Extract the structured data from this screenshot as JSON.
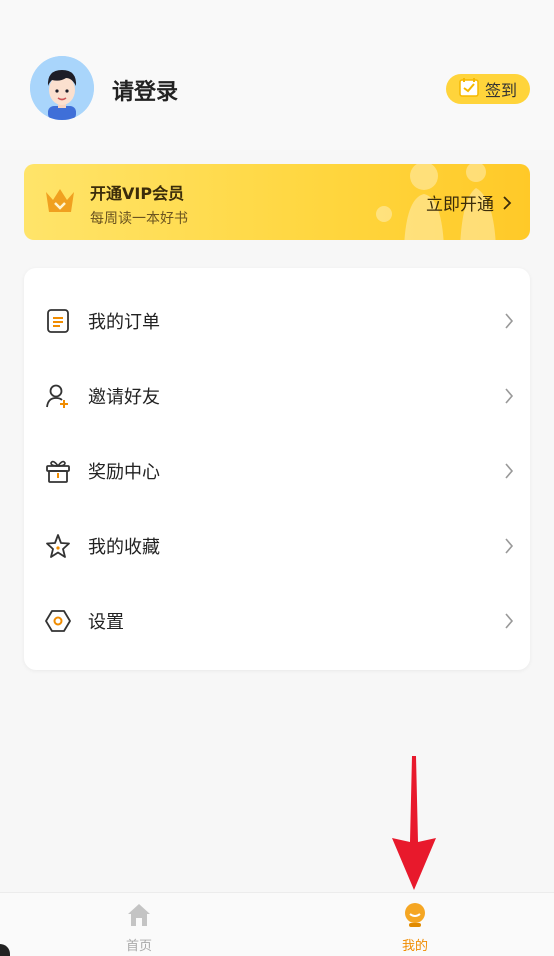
{
  "profile": {
    "login_label": "请登录",
    "signin_label": "签到"
  },
  "vip": {
    "title": "开通VIP会员",
    "subtitle": "每周读一本好书",
    "cta": "立即开通"
  },
  "menu": {
    "items": [
      {
        "label": "我的订单",
        "icon": "order-icon"
      },
      {
        "label": "邀请好友",
        "icon": "invite-friend-icon"
      },
      {
        "label": "奖励中心",
        "icon": "gift-icon"
      },
      {
        "label": "我的收藏",
        "icon": "star-icon"
      },
      {
        "label": "设置",
        "icon": "settings-icon"
      }
    ]
  },
  "tabbar": {
    "tabs": [
      {
        "label": "首页",
        "icon": "home-icon",
        "active": false
      },
      {
        "label": "我的",
        "icon": "mine-icon",
        "active": true
      }
    ]
  },
  "colors": {
    "accent": "#ffd43b",
    "active_tab": "#f08c00",
    "annotation_arrow": "#e8192c"
  }
}
